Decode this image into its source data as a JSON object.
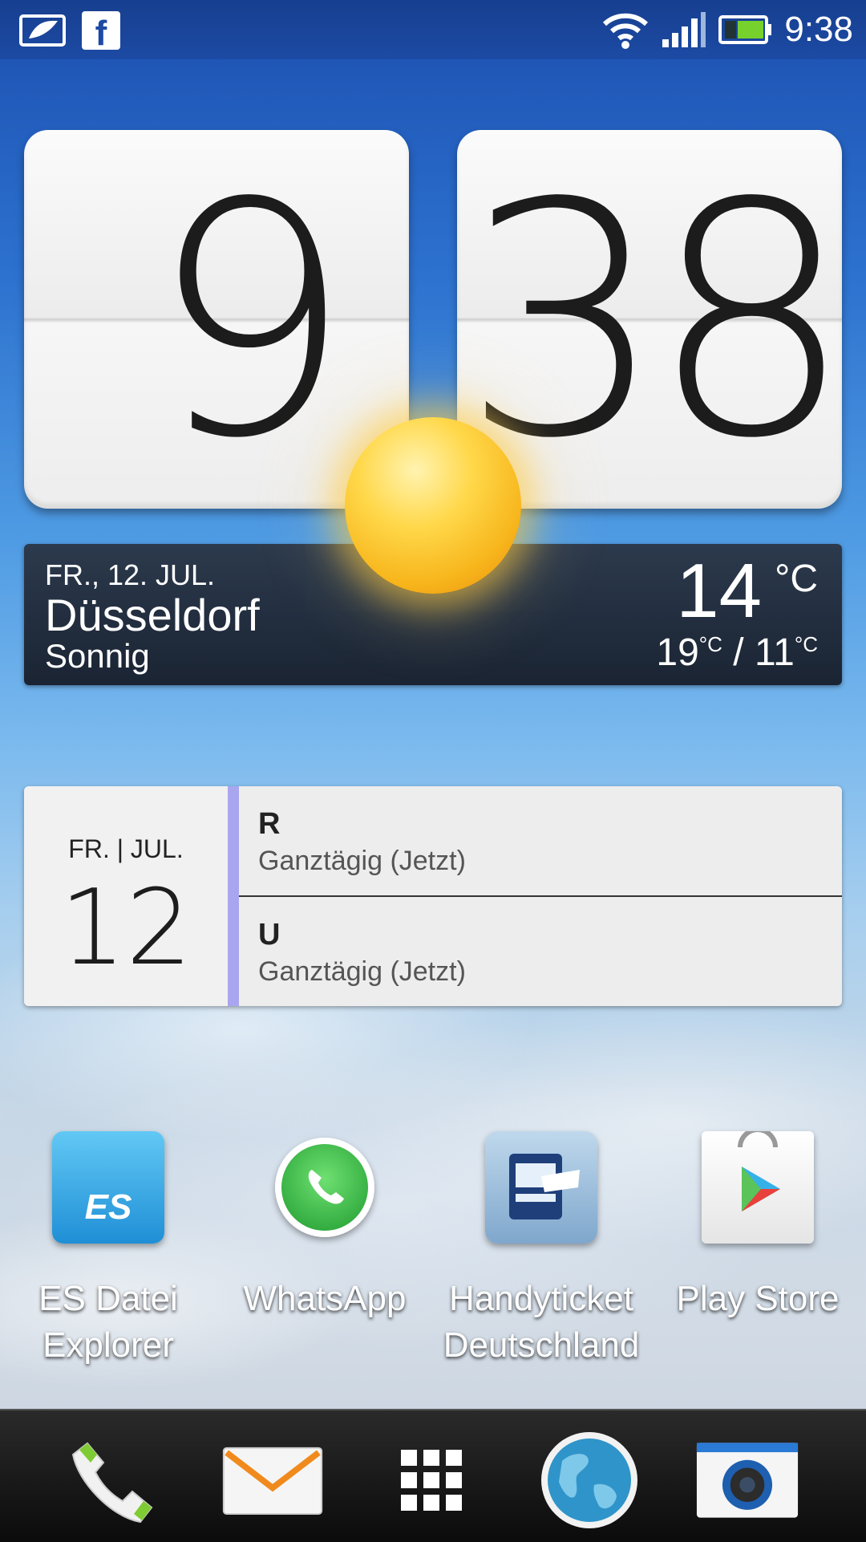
{
  "status_bar": {
    "time": "9:38",
    "icons": [
      "gallery-notification-icon",
      "facebook-icon",
      "wifi-icon",
      "signal-icon",
      "battery-icon"
    ],
    "facebook_glyph": "f"
  },
  "clock": {
    "hour": "9",
    "minute": "38"
  },
  "weather": {
    "date": "FR., 12. JUL.",
    "city": "Düsseldorf",
    "condition": "Sonnig",
    "temperature": "14",
    "temperature_unit": "°C",
    "high": "19",
    "low": "11",
    "range_unit": "°C",
    "range_separator": "/"
  },
  "calendar": {
    "day_of_week_month": "FR. | JUL.",
    "day": "12",
    "events": [
      {
        "title": "R",
        "subtitle": "Ganztägig (Jetzt)"
      },
      {
        "title": "U",
        "subtitle": "Ganztägig (Jetzt)"
      }
    ],
    "accent_color": "#a9a6ef"
  },
  "apps": [
    {
      "label": "ES Datei Explorer",
      "icon": "es-file-explorer-icon"
    },
    {
      "label": "WhatsApp",
      "icon": "whatsapp-icon"
    },
    {
      "label": "Handyticket Deutschland",
      "icon": "handyticket-icon"
    },
    {
      "label": "Play Store",
      "icon": "play-store-icon"
    }
  ],
  "dock": {
    "items": [
      "phone-icon",
      "mail-icon",
      "app-drawer-icon",
      "browser-globe-icon",
      "camera-icon"
    ]
  }
}
